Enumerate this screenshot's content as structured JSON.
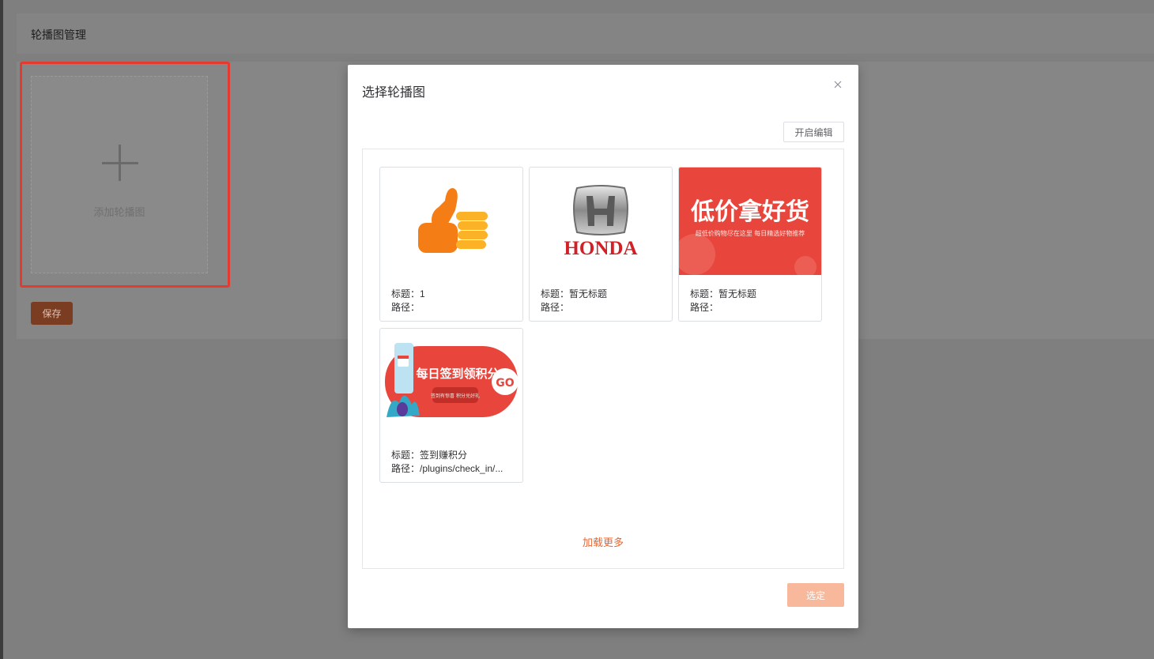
{
  "page": {
    "title": "轮播图管理",
    "add_label": "添加轮播图",
    "save_label": "保存"
  },
  "dialog": {
    "title": "选择轮播图",
    "edit_label": "开启编辑",
    "load_more": "加载更多",
    "confirm_label": "选定",
    "items": [
      {
        "title_line": "标题：1",
        "path_line": "路径：",
        "image": "thumbs-up-icon"
      },
      {
        "title_line": "标题：暂无标题",
        "path_line": "路径：",
        "image": "honda-logo",
        "logo_text": "HONDA"
      },
      {
        "title_line": "标题：暂无标题",
        "path_line": "路径：",
        "image": "low-price-banner",
        "banner_text": "低价拿好货",
        "banner_sub": "超低价购物尽在这里 每日精选好物推荐"
      },
      {
        "title_line": "标题：签到赚积分",
        "path_line": "路径：/plugins/check_in/...",
        "image": "check-in-banner",
        "banner_text": "每日签到领积分",
        "banner_sub": "签到有惊喜 积分兑好礼",
        "go_text": "GO"
      }
    ]
  },
  "colors": {
    "accent": "#e8652f",
    "highlight": "#e53a2f",
    "banner_red": "#e8453c"
  }
}
